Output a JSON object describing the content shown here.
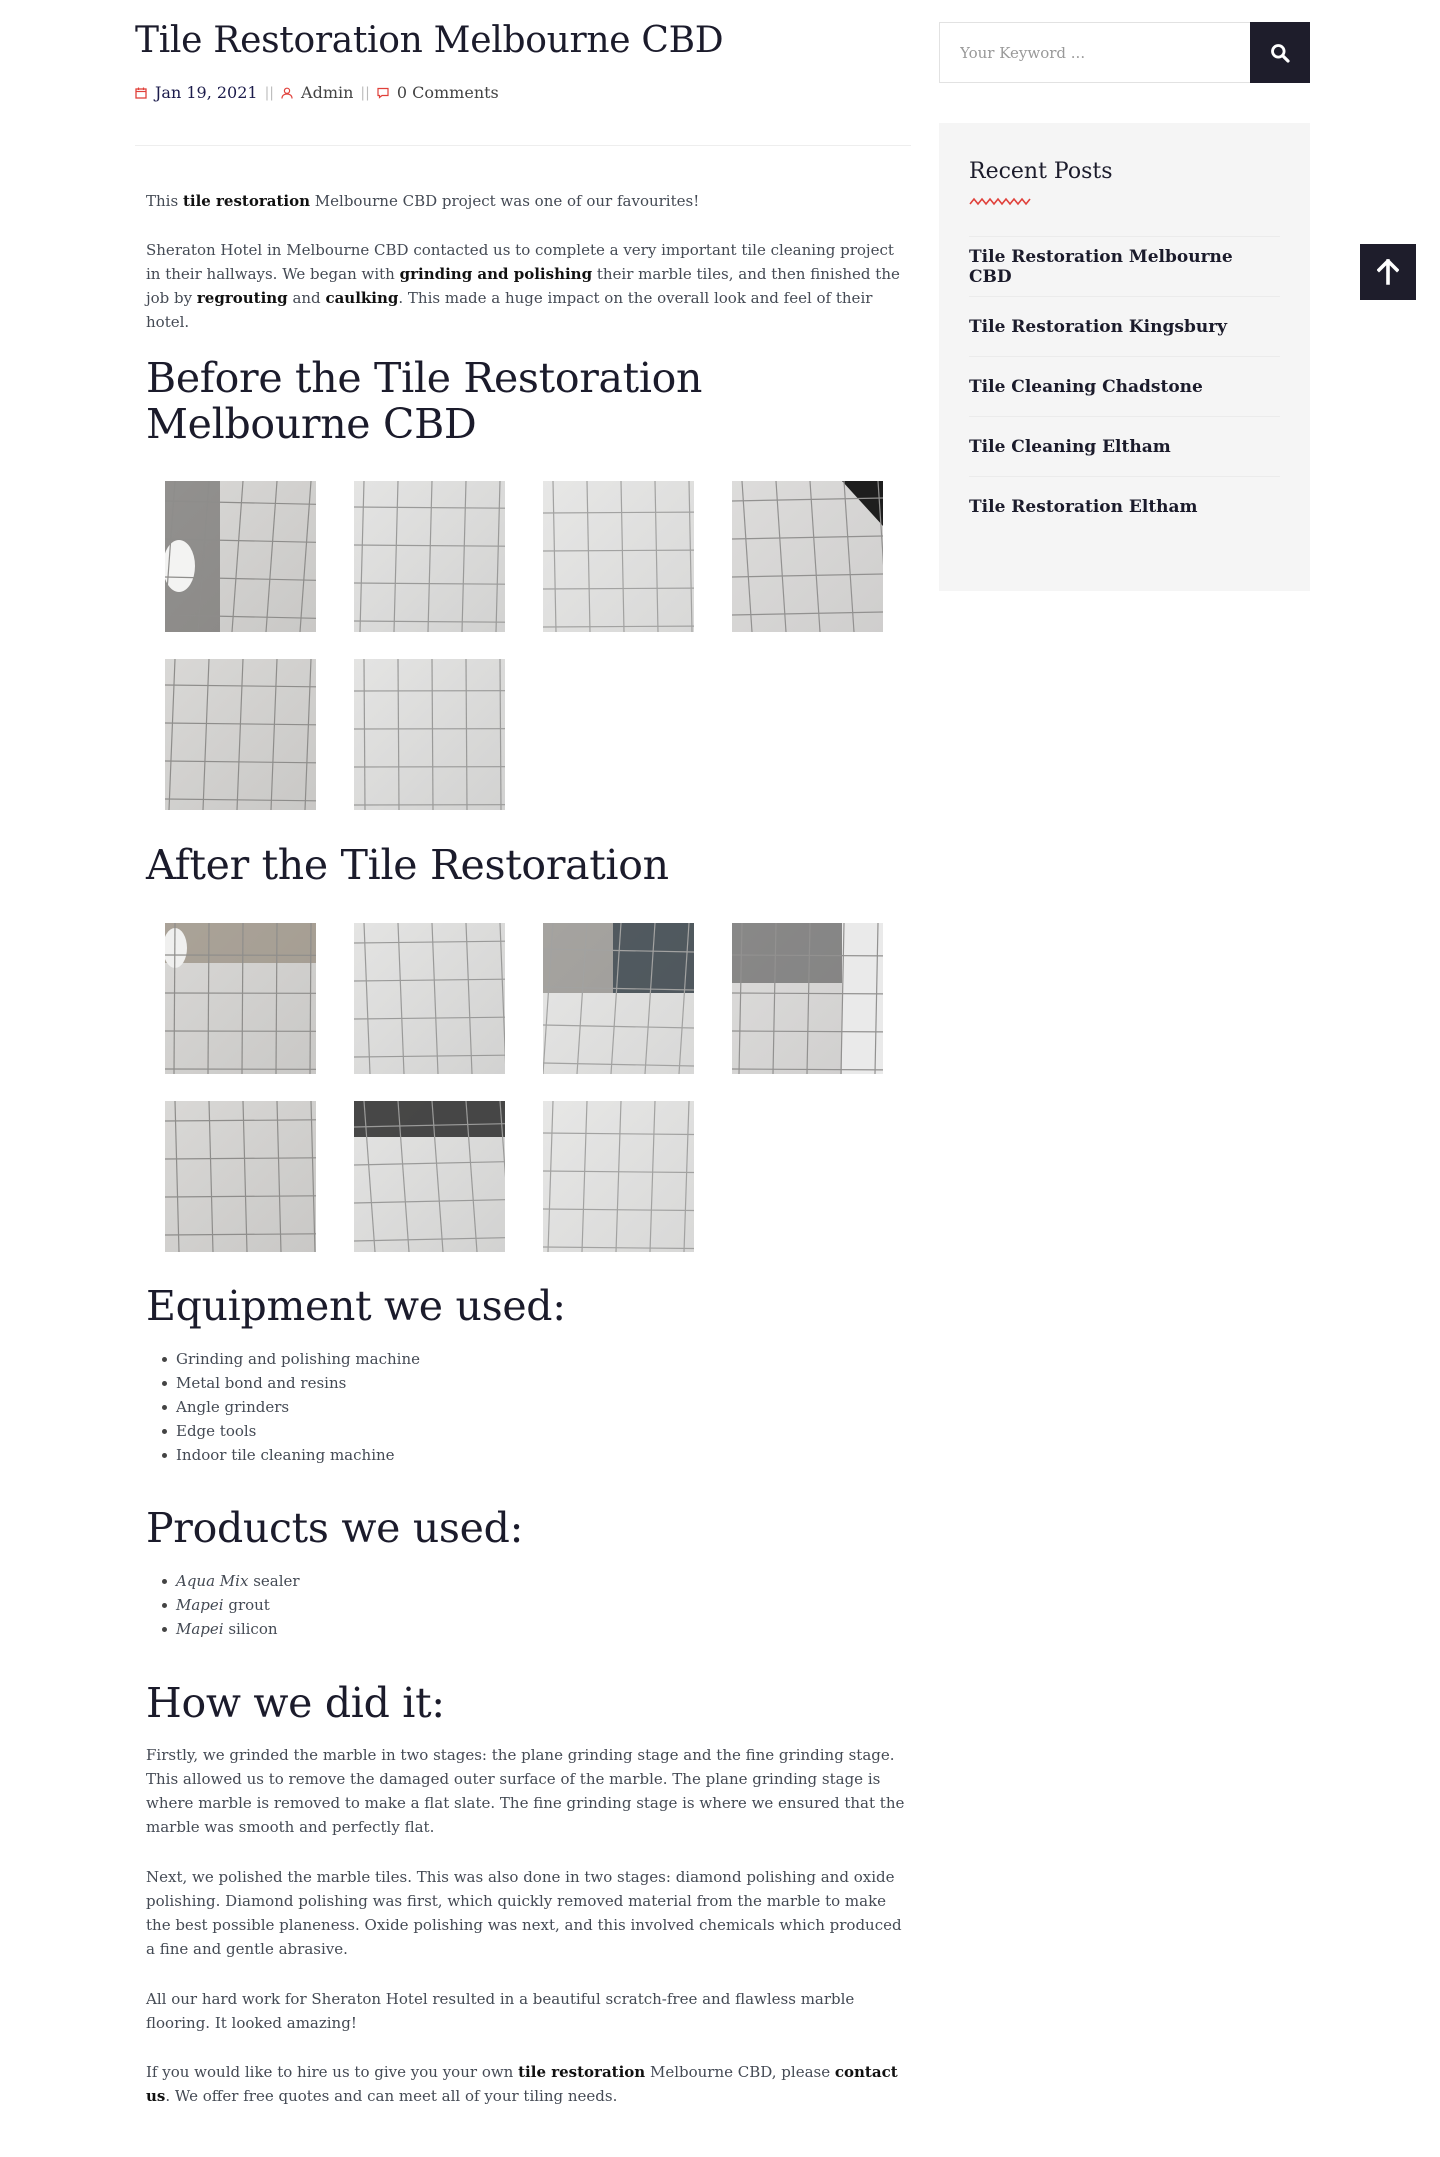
{
  "post": {
    "title": "Tile Restoration Melbourne CBD",
    "date": "Jan 19, 2021",
    "separator": "||",
    "author": "Admin",
    "comments": "0 Comments"
  },
  "intro": {
    "p1": [
      {
        "text": "This "
      },
      {
        "text": "tile restoration",
        "bold": true
      },
      {
        "text": " Melbourne CBD project was one of our favourites!"
      }
    ],
    "p2": [
      {
        "text": "Sheraton Hotel in Melbourne CBD contacted us to complete a very important tile cleaning project in their hallways. We began with "
      },
      {
        "text": "grinding and polishing",
        "bold": true
      },
      {
        "text": " their marble tiles, and then finished the job by "
      },
      {
        "text": "regrouting",
        "bold": true
      },
      {
        "text": " and "
      },
      {
        "text": "caulking",
        "bold": true
      },
      {
        "text": ". This made a huge impact on the overall look and feel of their hotel."
      }
    ]
  },
  "before": {
    "heading": "Before the Tile Restoration Melbourne CBD",
    "photo_count": 6
  },
  "after": {
    "heading": "After the Tile Restoration",
    "photo_count": 7
  },
  "equipment": {
    "heading": "Equipment we used:",
    "items": [
      "Grinding and polishing machine",
      "Metal bond and resins",
      "Angle grinders",
      "Edge tools",
      "Indoor tile cleaning machine"
    ]
  },
  "products": {
    "heading": "Products we used:",
    "items": [
      {
        "brand": "Aqua Mix",
        "rest": " sealer"
      },
      {
        "brand": "Mapei",
        "rest": " grout"
      },
      {
        "brand": "Mapei",
        "rest": " silicon"
      }
    ]
  },
  "how": {
    "heading": "How we did it:",
    "p1": "Firstly, we grinded the marble in two stages: the plane grinding stage and the fine grinding stage. This allowed us to remove the damaged outer surface of the marble. The plane grinding stage is where marble is removed to make a flat slate. The fine grinding stage is where we ensured that the marble was smooth and perfectly flat.",
    "p2": "Next, we polished the marble tiles. This was also done in two stages: diamond polishing and oxide polishing. Diamond polishing was first, which quickly removed material from the marble to make the best possible planeness. Oxide polishing was next, and this involved chemicals which produced a fine and gentle abrasive.",
    "p3": "All our hard work for Sheraton Hotel resulted in a beautiful scratch-free and flawless marble flooring. It looked amazing!",
    "p4": [
      {
        "text": "If you would like to hire us to give you your own "
      },
      {
        "text": "tile restoration",
        "bold": true
      },
      {
        "text": " Melbourne CBD, please "
      },
      {
        "text": "contact us",
        "bold": true,
        "link": true
      },
      {
        "text": ". We offer free quotes and can meet all of your tiling needs."
      }
    ]
  },
  "sidebar": {
    "search_placeholder": "Your Keyword ...",
    "recent_title": "Recent Posts",
    "recent_posts": [
      "Tile Restoration Melbourne CBD",
      "Tile Restoration Kingsbury",
      "Tile Cleaning Chadstone",
      "Tile Cleaning Eltham",
      "Tile Restoration Eltham"
    ]
  },
  "colors": {
    "accent_red": "#e0403a",
    "dark": "#1e1d2b",
    "sidebar_bg": "#f5f5f5"
  },
  "icons": {
    "search": "search-icon",
    "scroll_top": "arrow-up-icon",
    "date": "calendar-icon",
    "author": "user-icon",
    "comments": "comment-icon"
  }
}
